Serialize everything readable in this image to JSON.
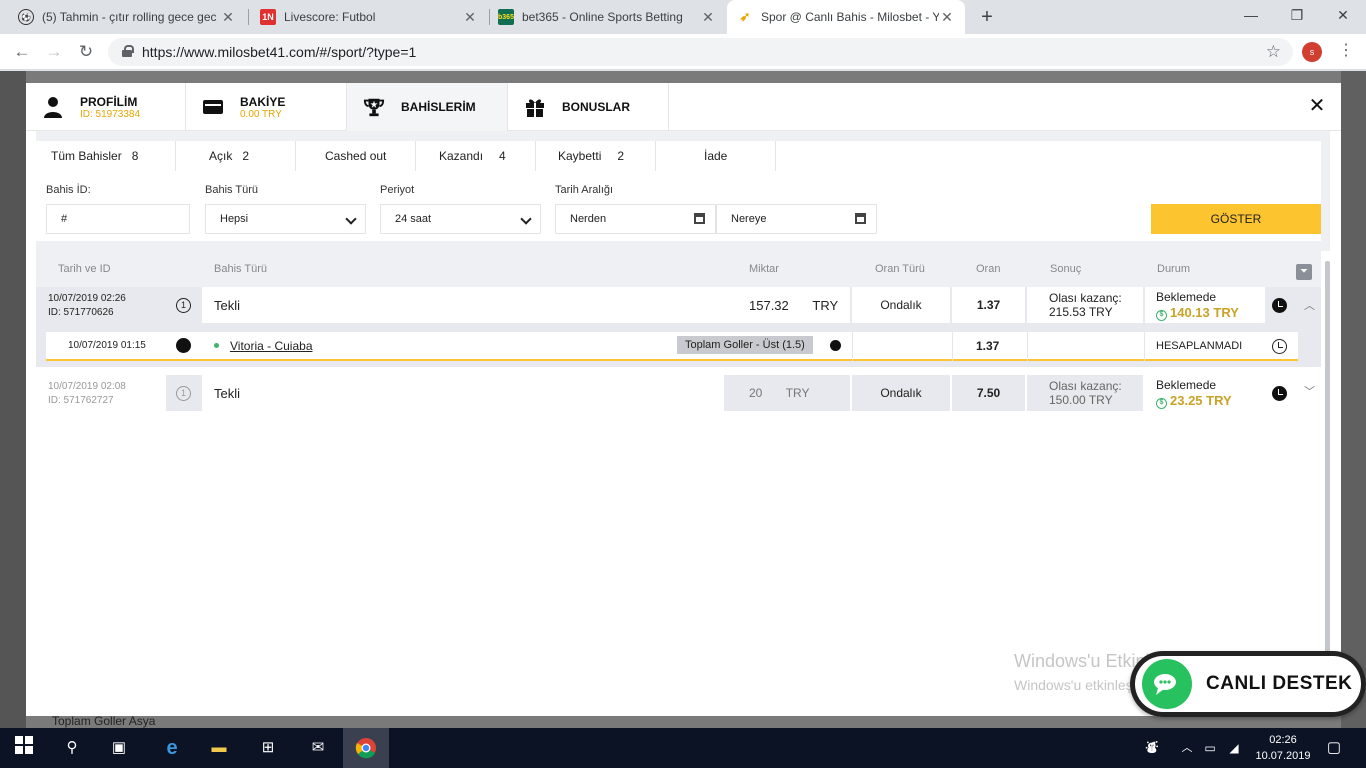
{
  "browser": {
    "tabs": [
      {
        "title": "(5) Tahmin - çıtır rolling gece gec",
        "icon": "soccer-ball-icon"
      },
      {
        "title": "Livescore: Futbol",
        "icon": "livescore-icon"
      },
      {
        "title": "bet365 - Online Sports Betting",
        "icon": "bet365-icon"
      },
      {
        "title": "Spor @ Canlı Bahis - Milosbet - Y",
        "icon": "milosbet-icon"
      }
    ],
    "url": "https://www.milosbet41.com/#/sport/?type=1",
    "profile_initial": "s"
  },
  "modal": {
    "tabs": [
      {
        "label": "PROFİLİM",
        "sub": "ID: 51973384",
        "icon": "user-icon"
      },
      {
        "label": "BAKİYE",
        "sub": "0.00 TRY",
        "icon": "wallet-icon"
      },
      {
        "label": "BAHİSLERİM",
        "sub": "",
        "icon": "trophy-icon"
      },
      {
        "label": "BONUSLAR",
        "sub": "",
        "icon": "gift-icon"
      }
    ],
    "filter_tabs": [
      {
        "label": "Tüm Bahisler",
        "count": "8"
      },
      {
        "label": "Açık",
        "count": "2"
      },
      {
        "label": "Cashed out",
        "count": ""
      },
      {
        "label": "Kazandı",
        "count": "4"
      },
      {
        "label": "Kaybetti",
        "count": "2"
      },
      {
        "label": "İade",
        "count": ""
      }
    ],
    "form": {
      "bet_id_label": "Bahis İD:",
      "bet_id_value": "#",
      "bet_type_label": "Bahis Türü",
      "bet_type_value": "Hepsi",
      "period_label": "Periyot",
      "period_value": "24 saat",
      "date_range_label": "Tarih Aralığı",
      "from_placeholder": "Nerden",
      "to_placeholder": "Nereye",
      "show_button": "GÖSTER"
    },
    "table": {
      "headers": {
        "date_id": "Tarih ve ID",
        "bet_type": "Bahis Türü",
        "amount": "Miktar",
        "odds_type": "Oran Türü",
        "odds": "Oran",
        "result": "Sonuç",
        "status": "Durum"
      },
      "bets": [
        {
          "date": "10/07/2019 02:26",
          "id": "ID: 571770626",
          "number": "1",
          "type": "Tekli",
          "amount": "157.32",
          "currency": "TRY",
          "odds_type": "Ondalık",
          "odds": "1.37",
          "result_label": "Olası kazanç:",
          "result_value": "215.53 TRY",
          "status": "Beklemede",
          "cashout": "140.13 TRY"
        },
        {
          "date": "10/07/2019 02:08",
          "id": "ID: 571762727",
          "number": "1",
          "type": "Tekli",
          "amount": "20",
          "currency": "TRY",
          "odds_type": "Ondalık",
          "odds": "7.50",
          "result_label": "Olası kazanç:",
          "result_value": "150.00 TRY",
          "status": "Beklemede",
          "cashout": "23.25 TRY"
        }
      ],
      "selection": {
        "date": "10/07/2019 01:15",
        "match": "Vitoria - Cuiaba",
        "market": "Toplam Goller - Üst (1.5)",
        "odds": "1.37",
        "status": "HESAPLANMADI"
      }
    }
  },
  "background": {
    "footer_text": "Toplam Goller Asya"
  },
  "overlay": {
    "watermark_title": "Windows'u Etkinleştir",
    "watermark_sub": "Windows'u etkinleştirmek için Ayarlar'a gidin.",
    "support_label": "CANLI DESTEK"
  },
  "taskbar": {
    "time": "02:26",
    "date": "10.07.2019"
  },
  "colors": {
    "accent": "#fcc42f",
    "cashout": "#c9a227",
    "green": "#3bb56b"
  }
}
